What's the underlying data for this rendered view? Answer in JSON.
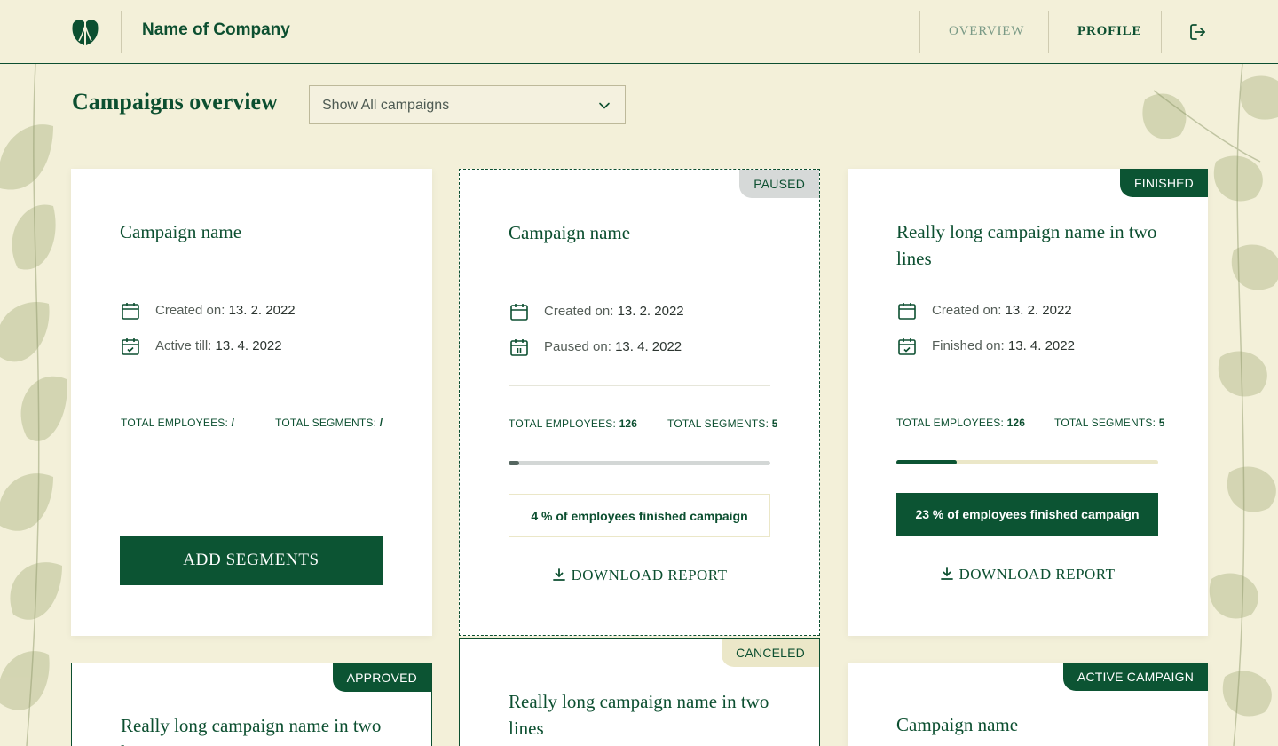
{
  "header": {
    "brand": "Name of Company",
    "nav": {
      "overview": "OVERVIEW",
      "profile": "PROFILE"
    }
  },
  "page": {
    "title": "Campaigns overview",
    "filter": {
      "selected": "Show All campaigns"
    }
  },
  "cards": [
    {
      "title": "Campaign name",
      "created_label": "Created on:",
      "created_value": "13. 2. 2022",
      "second_label": "Active till:",
      "second_value": "13. 4. 2022",
      "employees_label": "TOTAL EMPLOYEES:",
      "employees_value": "/",
      "segments_label": "TOTAL SEGMENTS:",
      "segments_value": "/",
      "button": "ADD SEGMENTS"
    },
    {
      "status": "PAUSED",
      "title": "Campaign name",
      "created_label": "Created on:",
      "created_value": "13. 2. 2022",
      "second_label": "Paused on:",
      "second_value": "13. 4. 2022",
      "employees_label": "TOTAL EMPLOYEES:",
      "employees_value": "126",
      "segments_label": "TOTAL SEGMENTS:",
      "segments_value": "5",
      "progress": 0.04,
      "result": "4 % of employees finished campaign",
      "download": "DOWNLOAD REPORT"
    },
    {
      "status": "FINISHED",
      "title": "Really long campaign name in two lines",
      "created_label": "Created on:",
      "created_value": "13. 2. 2022",
      "second_label": "Finished on:",
      "second_value": "13. 4. 2022",
      "employees_label": "TOTAL EMPLOYEES:",
      "employees_value": "126",
      "segments_label": "TOTAL SEGMENTS:",
      "segments_value": "5",
      "progress": 0.23,
      "result": "23 % of employees finished campaign",
      "download": "DOWNLOAD REPORT"
    },
    {
      "status": "APPROVED",
      "title": "Really long campaign name in two lines"
    },
    {
      "status": "CANCELED",
      "title": "Really long campaign name in two lines"
    },
    {
      "status": "ACTIVE CAMPAIGN",
      "title": "Campaign name"
    }
  ],
  "colors": {
    "brand": "#0c4f30",
    "background": "#f3f0d9",
    "paused_badge": "#d6d9d8",
    "canceled_badge": "#ebe7c8",
    "progress_track_paused": "#d3d7d6",
    "progress_track_finished": "#ebe7c8"
  },
  "icons": [
    "leaf-logo-icon",
    "logout-icon",
    "chevron-down-icon",
    "calendar-icon",
    "calendar-check-icon",
    "calendar-pause-icon",
    "download-icon"
  ]
}
